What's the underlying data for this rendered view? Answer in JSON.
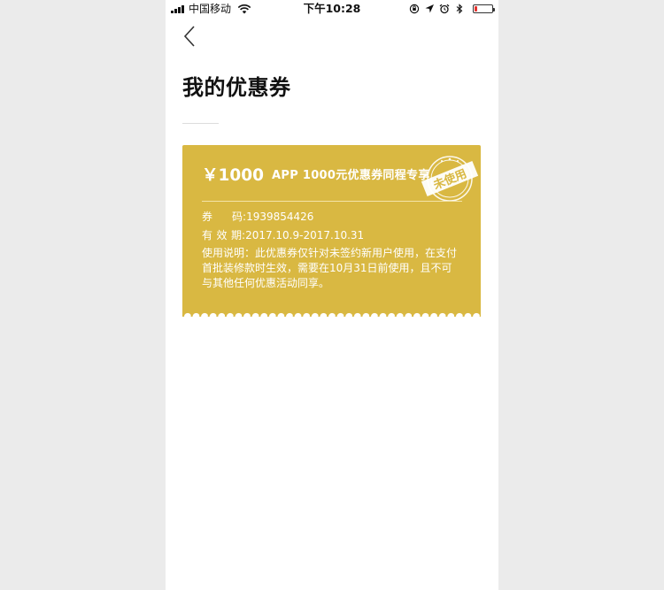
{
  "status_bar": {
    "carrier": "中国移动",
    "time": "下午10:28",
    "battery_level": 0.18
  },
  "header": {
    "title": "我的优惠券"
  },
  "coupon": {
    "amount": "￥1000",
    "name": "APP 1000元优惠券同程专享",
    "stamp_text": "未使用",
    "code_label": "券码",
    "code_value": "1939854426",
    "valid_label": "有效期",
    "valid_value": "2017.10.9-2017.10.31",
    "description": "使用说明：此优惠券仅针对未签约新用户使用，在支付首批装修款时生效，需要在10月31日前使用，且不可与其他任何优惠活动同享。",
    "colors": {
      "card": "#d9b842",
      "text": "#ffffff"
    }
  },
  "icons": {
    "back": "chevron-left-icon",
    "wifi": "wifi-icon",
    "orientation_lock": "orientation-lock-icon",
    "location": "location-arrow-icon",
    "alarm": "alarm-clock-icon",
    "bluetooth": "bluetooth-icon",
    "battery": "battery-icon"
  }
}
